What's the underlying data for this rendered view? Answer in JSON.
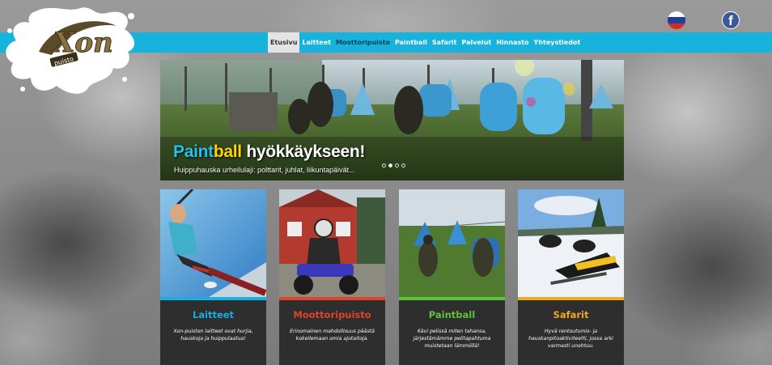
{
  "nav": {
    "items": [
      {
        "label": "Etusivu",
        "active": true
      },
      {
        "label": "Laitteet"
      },
      {
        "label": "Moottoripuisto"
      },
      {
        "label": "Paintball"
      },
      {
        "label": "Safarit"
      },
      {
        "label": "Palvelut"
      },
      {
        "label": "Hinnasto"
      },
      {
        "label": "Yhteystiedot"
      }
    ]
  },
  "logo": {
    "brand": "Xon",
    "sub": "puisto"
  },
  "header_icons": {
    "language": "russian-flag-icon",
    "social": "facebook-icon",
    "facebook_glyph": "f"
  },
  "hero": {
    "title_part1": "Paint",
    "title_part2": "ball",
    "title_part3": " hyökkäykseen!",
    "subtitle": "Huippuhauska urheilulaji: polttarit, juhlat, liikuntapäivät...",
    "slide_count": 4,
    "active_slide": 2
  },
  "cards": [
    {
      "title": "Laitteet",
      "desc": "Xon-puiston laitteet ovat hurjia, hauskoja ja huippulaatua!",
      "color": "#19aee0"
    },
    {
      "title": "Moottoripuisto",
      "desc": "Erinomainen mahdollisuus päästä kokeilemaan omia ajotaitoja.",
      "color": "#e0432a"
    },
    {
      "title": "Paintball",
      "desc": "Kävi pelissä miten tahansa, järjestämämme pelitapahtuma muistetaan lämmöllä!",
      "color": "#5cc43c"
    },
    {
      "title": "Safarit",
      "desc": "Hyvä rentoutumis- ja hauskanpitoaktiviteetti, jossa arki varmasti unohtuu.",
      "color": "#f0a820"
    }
  ]
}
